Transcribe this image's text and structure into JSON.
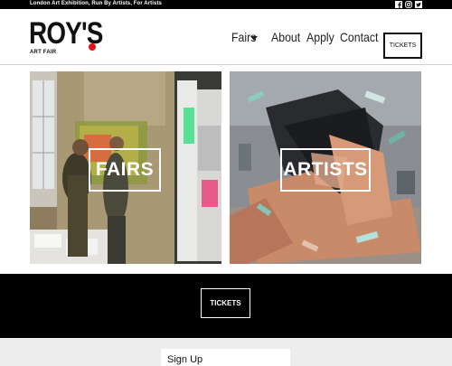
{
  "topbar": {
    "tagline": "London Art Exhibition, Run By Artists, For Artists",
    "social_icons": [
      "facebook-icon",
      "instagram-icon",
      "twitter-icon"
    ]
  },
  "header": {
    "logo_text": "ROY'S",
    "logo_subtitle": "ART FAIR",
    "nav": {
      "fairs": "Fairs",
      "about": "About",
      "apply": "Apply",
      "contact": "Contact"
    },
    "tickets_label": "TICKETS"
  },
  "panels": {
    "fairs_label": "FAIRS",
    "artists_label": "ARTISTS"
  },
  "band": {
    "tickets_label": "TICKETS"
  },
  "footer": {
    "signup_title": "Sign Up"
  },
  "colors": {
    "accent_dot": "#e3111b",
    "topbar": "#000000",
    "band": "#000000",
    "footer": "#ededed"
  }
}
